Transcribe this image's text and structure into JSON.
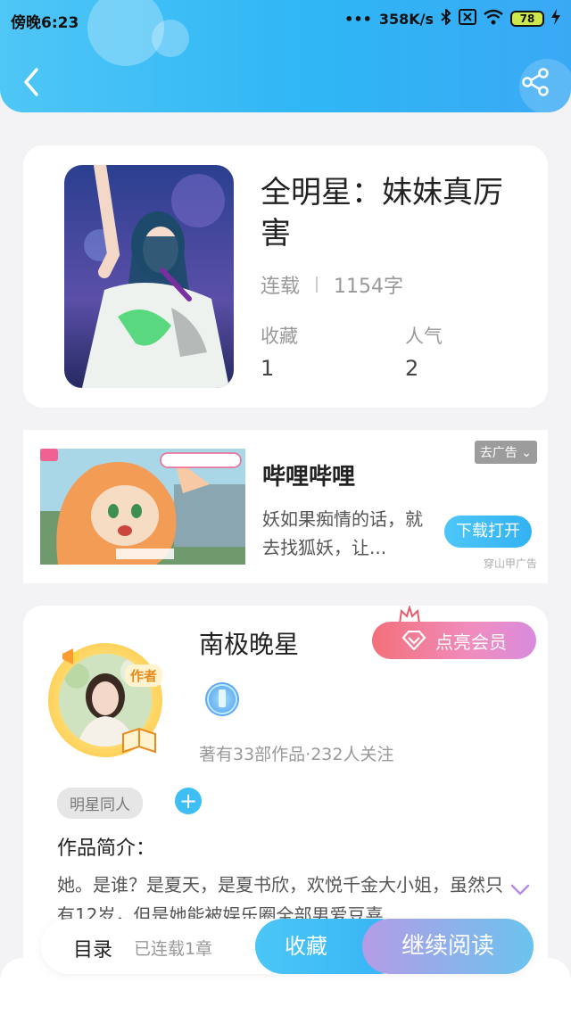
{
  "status_bar": {
    "time": "傍晚6:23",
    "network_speed": "358K/s",
    "battery": "78"
  },
  "header": {
    "back_icon": "chevron-left-icon",
    "share_icon": "share-icon"
  },
  "book": {
    "title": "全明星：妹妹真厉害",
    "status": "连载",
    "word_count": "1154字",
    "favorites_label": "收藏",
    "favorites_value": "1",
    "popularity_label": "人气",
    "popularity_value": "2"
  },
  "ad": {
    "title": "哔哩哔哩",
    "description": "妖如果痴情的话，就去找狐妖，让...",
    "close_label": "去广告",
    "download_label": "下载打开",
    "source": "穿山甲广告"
  },
  "author": {
    "name": "南极晚星",
    "badge": "作者",
    "vip_label": "点亮会员",
    "stats": "著有33部作品·232人关注",
    "tag": "明星同人",
    "intro_label": "作品简介：",
    "intro_text": "她。是谁？是夏天，是夏书欣，欢悦千金大小姐，虽然只有12岁，但是她能被娱乐圈全部男爱豆喜"
  },
  "bottom_bar": {
    "toc_label": "目录",
    "toc_sub": "已连载1章",
    "favorite_label": "收藏",
    "read_label": "继续阅读"
  }
}
